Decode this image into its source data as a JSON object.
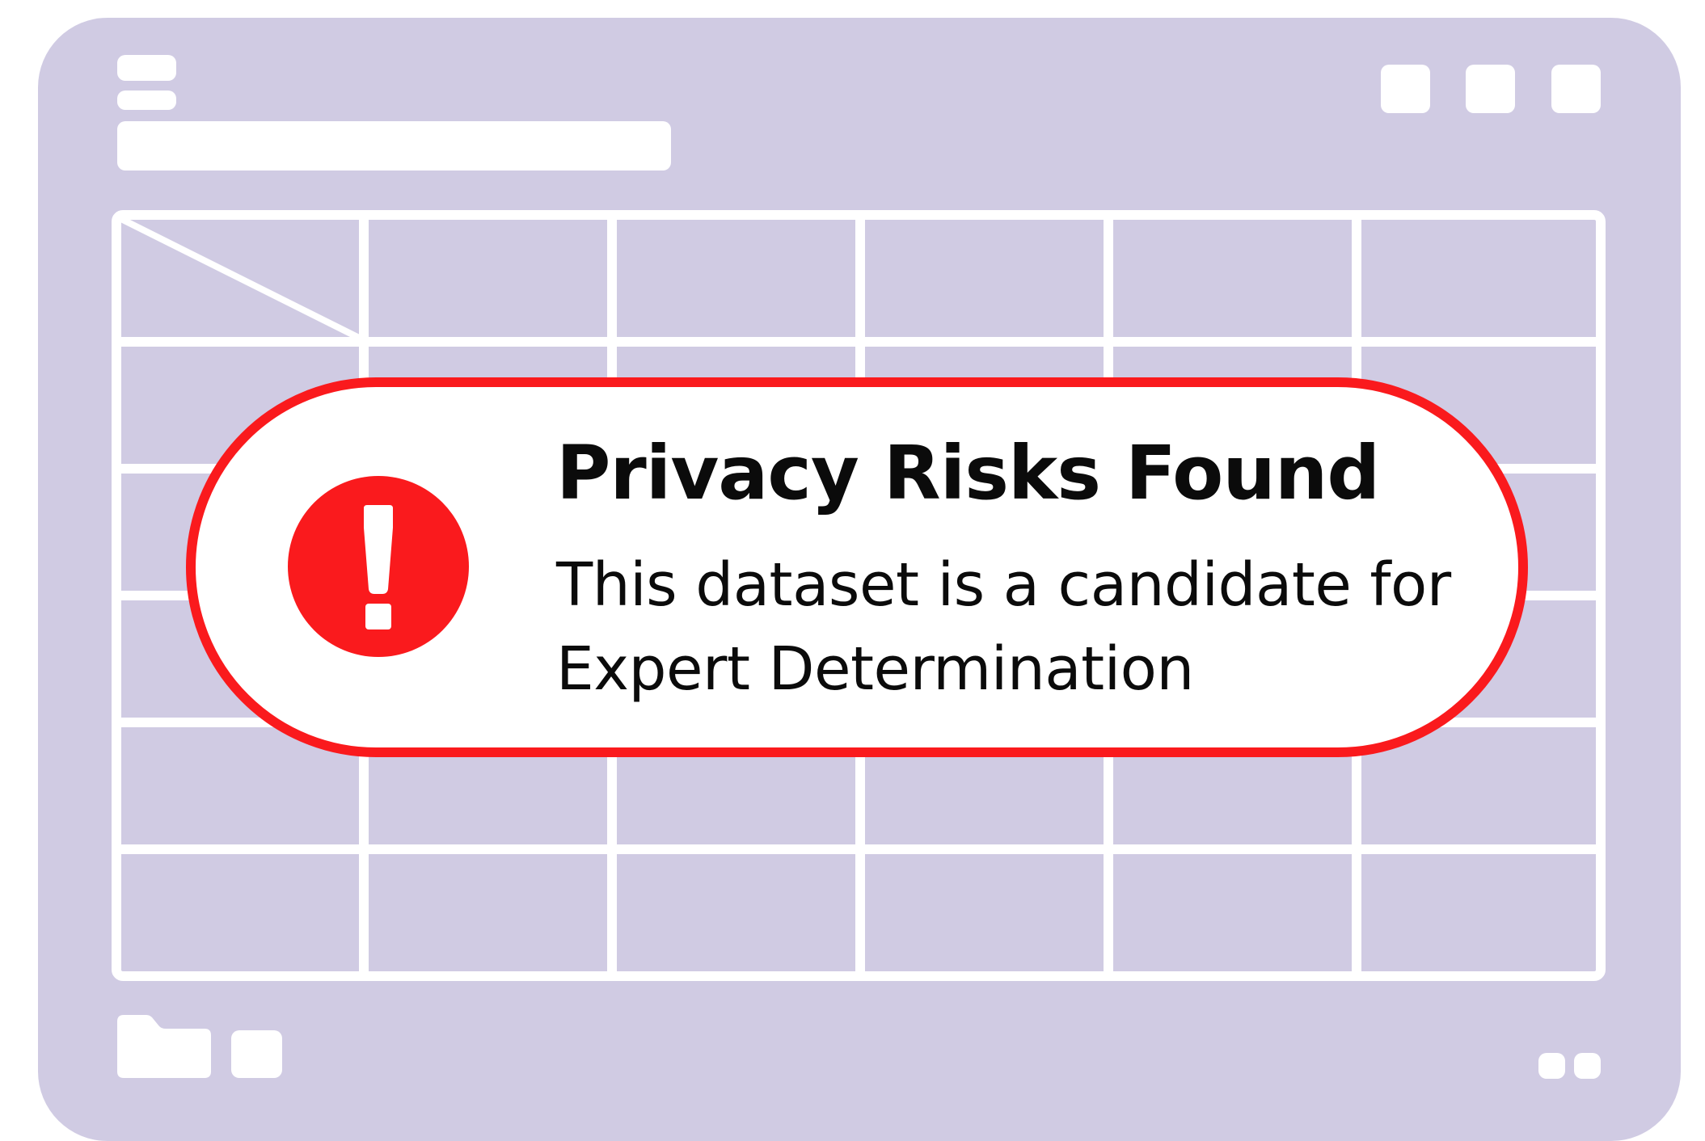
{
  "colors": {
    "window_background": "#d0cbe3",
    "surface": "#ffffff",
    "alert_accent": "#fa1a1d",
    "text": "#0b0b0b"
  },
  "icons": {
    "menu": "hamburger-menu-icon",
    "window_controls": [
      "window-control-icon",
      "window-control-icon",
      "window-control-icon"
    ],
    "folder": "folder-icon",
    "alert": "exclamation-circle-icon"
  },
  "alert": {
    "title": "Privacy Risks Found",
    "message": "This dataset is a candidate for Expert Determination"
  },
  "table": {
    "columns": 6,
    "rows": 6
  }
}
